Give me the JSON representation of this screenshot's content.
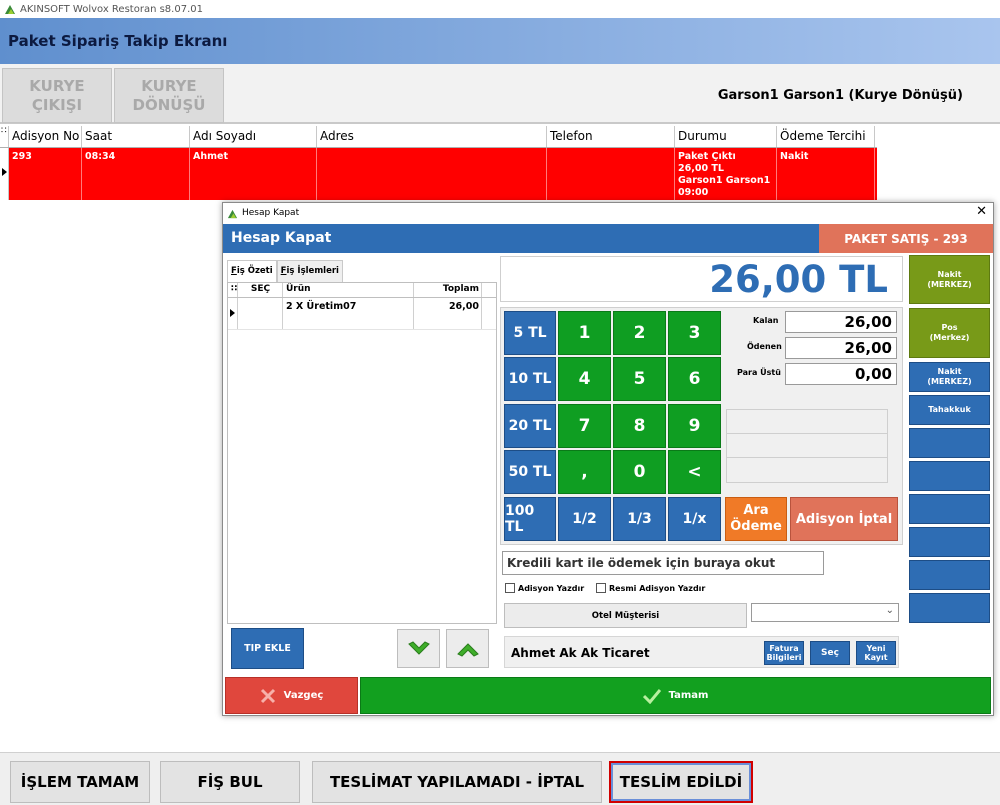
{
  "window": {
    "title": "AKINSOFT Wolvox Restoran s8.07.01",
    "header": "Paket Sipariş Takip Ekranı"
  },
  "toolbar": {
    "kurye_cikisi": [
      "KURYE",
      "ÇIKIŞI"
    ],
    "kurye_donusu": [
      "KURYE",
      "DÖNÜŞÜ"
    ],
    "garson": "Garson1 Garson1 (Kurye Dönüşü)"
  },
  "grid": {
    "columns": [
      "Adisyon No",
      "Saat",
      "Adı Soyadı",
      "Adres",
      "Telefon",
      "Durumu",
      "Ödeme Tercihi"
    ],
    "row": {
      "adisyon_no": "293",
      "saat": "08:34",
      "adi": "Ahmet",
      "adres": "",
      "telefon": "",
      "durum": [
        "Paket Çıktı",
        "26,00 TL",
        "Garson1 Garson1",
        "09:00"
      ],
      "odeme": "Nakit"
    }
  },
  "dialog": {
    "title": "Hesap Kapat",
    "header": "Hesap Kapat",
    "paket": "PAKET SATIŞ - 293",
    "tabs": {
      "fis_ozeti_first": "F",
      "fis_ozeti_rest": "iş Özeti",
      "fis_islemleri_first": "F",
      "fis_islemleri_rest": "iş İşlemleri"
    },
    "fis_columns": [
      "SEÇ",
      "Ürün",
      "Toplam"
    ],
    "fis_row": {
      "urun": "2 X Üretim07",
      "toplam": "26,00"
    },
    "tip_ekle": "TIP EKLE",
    "total": "26,00 TL",
    "amount_keys": [
      "5 TL",
      "10 TL",
      "20 TL",
      "50 TL",
      "100 TL"
    ],
    "num_keys": [
      "1",
      "2",
      "3",
      "4",
      "5",
      "6",
      "7",
      "8",
      "9",
      ",",
      "0",
      "<"
    ],
    "fraction_keys": [
      "1/2",
      "1/3",
      "1/x"
    ],
    "ara_odeme": [
      "Ara",
      "Ödeme"
    ],
    "adisyon_iptal": "Adisyon İptal",
    "kalan_label": "Kalan",
    "kalan": "26,00",
    "odenen_label": "Ödenen",
    "odenen": "26,00",
    "para_ustu_label": "Para Üstü",
    "para_ustu": "0,00",
    "kredi_placeholder": "Kredili kart ile ödemek için buraya okut",
    "adisyon_yazdir": "Adisyon Yazdır",
    "resmi_adisyon_yazdir": "Resmi Adisyon Yazdır",
    "otel_musterisi": "Otel Müşterisi",
    "customer": "Ahmet Ak Ak Ticaret",
    "fatura": [
      "Fatura",
      "Bilgileri"
    ],
    "sec": "Seç",
    "yeni_kayit": [
      "Yeni",
      "Kayıt"
    ],
    "payment_methods": [
      [
        "Nakit",
        "(MERKEZ)"
      ],
      [
        "Pos",
        "(Merkez)"
      ],
      [
        "Nakit",
        "(MERKEZ)"
      ],
      [
        "Tahakkuk"
      ]
    ],
    "vazgec": "Vazgeç",
    "tamam": "Tamam"
  },
  "bottom": {
    "islem_tamam": "İŞLEM TAMAM",
    "fis_bul": "FİŞ BUL",
    "teslimat_iptal": "TESLİMAT YAPILAMADI - İPTAL",
    "teslim_edildi": "TESLİM EDİLDİ"
  },
  "colors": {
    "accent_blue": "#2e6db4",
    "keypad_green": "#0f9e22",
    "row_red": "#ff0000",
    "paket_salmon": "#e0735a",
    "olive": "#789a18"
  }
}
